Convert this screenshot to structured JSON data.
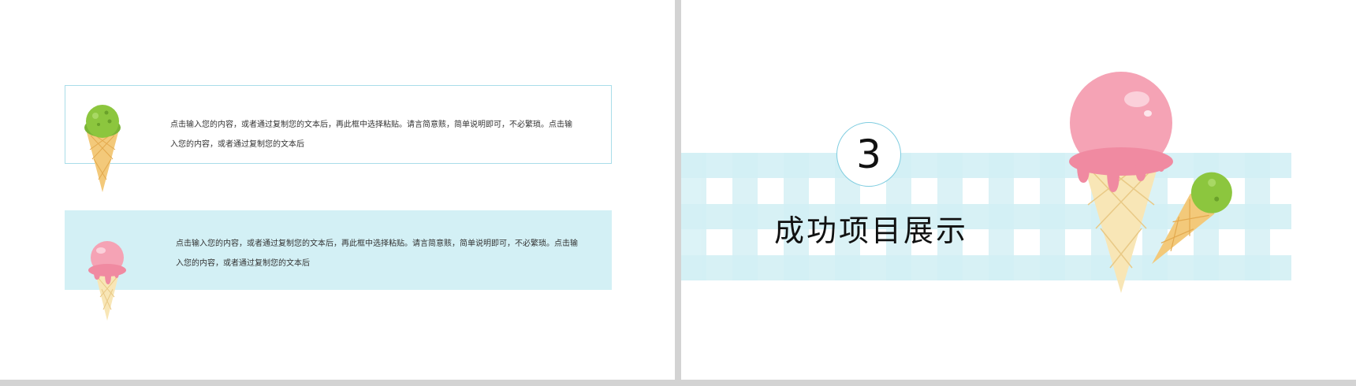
{
  "left_slide": {
    "items": [
      {
        "text": "点击输入您的内容，或者通过复制您的文本后，再此框中选择粘贴。请言简意赅，简单说明即可，不必繁琐。点击输入您的内容，或者通过复制您的文本后",
        "icon": "green-ice-cream-cone-icon"
      },
      {
        "text": "点击输入您的内容，或者通过复制您的文本后，再此框中选择粘贴。请言简意赅，简单说明即可，不必繁琐。点击输入您的内容，或者通过复制您的文本后",
        "icon": "pink-ice-cream-cone-icon"
      }
    ]
  },
  "right_slide": {
    "section_number": "3",
    "section_title": "成功项目展示"
  },
  "colors": {
    "accent": "#7fcde0",
    "light": "#d3f0f5",
    "pink": "#f5a3b5",
    "green": "#8cc63e",
    "cone": "#f3c97a"
  }
}
